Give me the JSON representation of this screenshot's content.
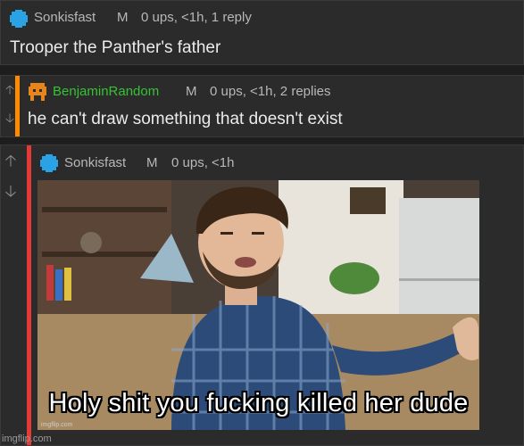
{
  "comments": [
    {
      "username": "Sonkisfast",
      "badge": "M",
      "meta": "0 ups, <1h, 1 reply",
      "text": "Trooper the Panther's father",
      "bar_color": "#ffffff",
      "name_color": "#b8b8b8"
    },
    {
      "username": "BenjaminRandom",
      "badge": "M",
      "meta": "0 ups, <1h, 2 replies",
      "text": "he can't draw something that doesn't exist",
      "bar_color": "#ff8c00",
      "name_color": "#35c335"
    },
    {
      "username": "Sonkisfast",
      "badge": "M",
      "meta": "0 ups, <1h",
      "text": "",
      "bar_color": "#e53935",
      "name_color": "#b8b8b8"
    }
  ],
  "image": {
    "caption": "Holy shit you fucking killed her dude"
  },
  "watermark": "imgflip.com",
  "icons": {
    "upvote": "arrow-up-icon",
    "downvote": "arrow-down-icon"
  }
}
